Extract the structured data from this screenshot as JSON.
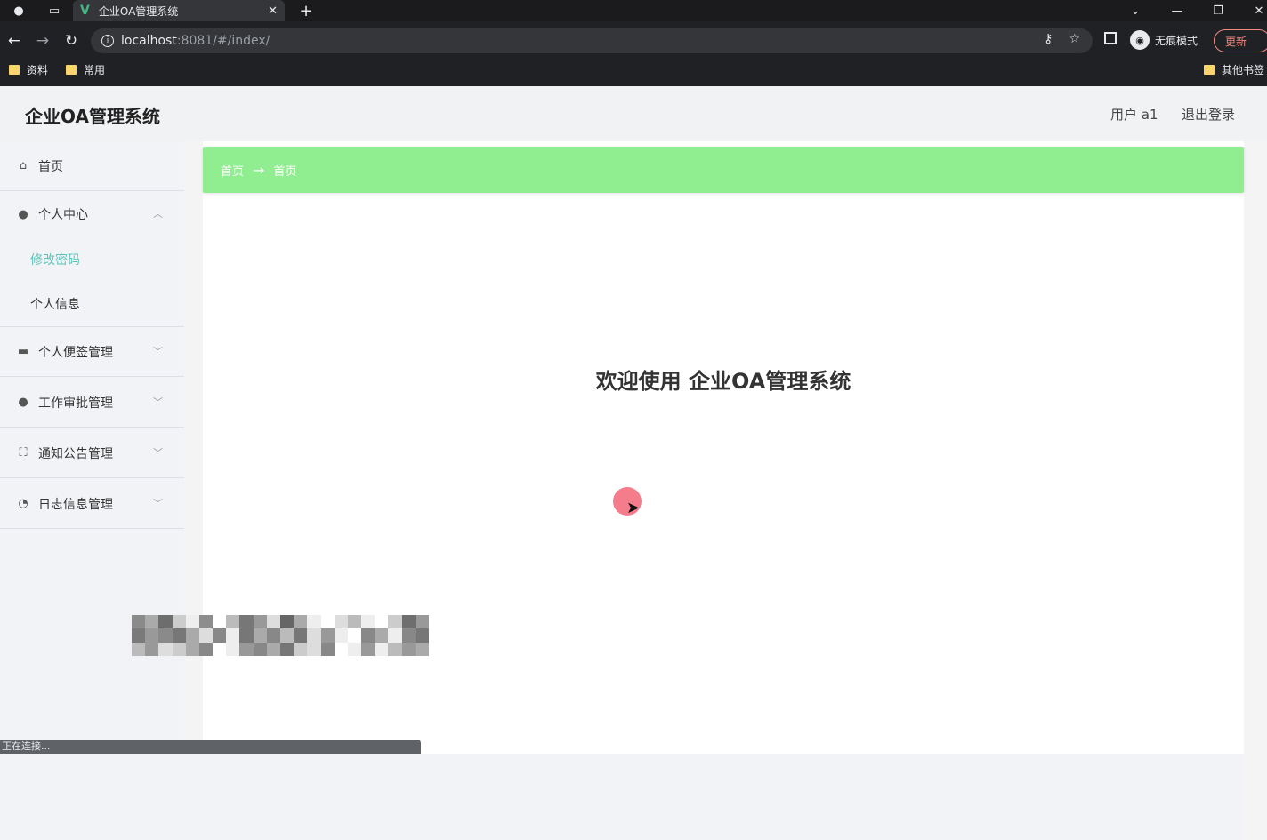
{
  "browser": {
    "tab_title": "企业OA管理系统",
    "url_host": "localhost",
    "url_rest": ":8081/#/index/",
    "incognito_label": "无痕模式",
    "update_label": "更新",
    "bookmarks": [
      "资料",
      "常用"
    ],
    "other_bookmarks": "其他书签",
    "status_text": "正在连接..."
  },
  "header": {
    "brand": "企业OA管理系统",
    "user": "用户 a1",
    "logout": "退出登录"
  },
  "sidebar": {
    "home": "首页",
    "personal_center": "个人中心",
    "sub_change_password": "修改密码",
    "sub_personal_info": "个人信息",
    "notes_mgmt": "个人便签管理",
    "approval_mgmt": "工作审批管理",
    "notice_mgmt": "通知公告管理",
    "log_mgmt": "日志信息管理"
  },
  "main": {
    "breadcrumb_root": "首页",
    "breadcrumb_sep": "→",
    "breadcrumb_current": "首页",
    "welcome": "欢迎使用 企业OA管理系统"
  },
  "colors": {
    "breadcrumb_bg": "#90ee90",
    "active_sub": "#5fc3b9"
  }
}
